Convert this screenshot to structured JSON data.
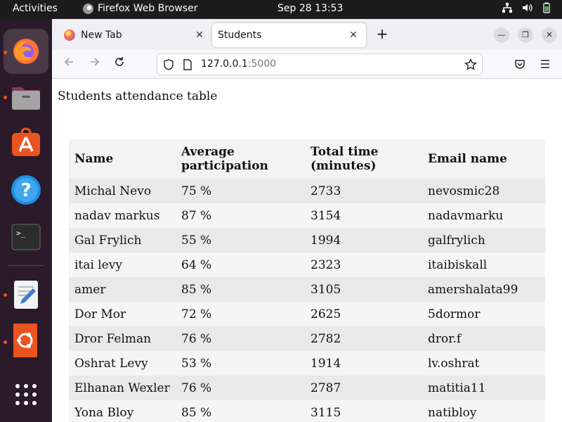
{
  "topbar": {
    "activities": "Activities",
    "app_name": "Firefox Web Browser",
    "datetime": "Sep 28  13:53"
  },
  "dock": {
    "items": [
      "firefox-icon",
      "files-icon",
      "app-center-icon",
      "help-icon",
      "terminal-icon",
      "text-editor-icon",
      "ubuntu-software-icon",
      "show-apps-icon"
    ]
  },
  "browser": {
    "tabs": [
      {
        "label": "New Tab",
        "active": false
      },
      {
        "label": "Students",
        "active": true
      }
    ],
    "url_host": "127.0.0.1",
    "url_port": ":5000"
  },
  "page": {
    "title": "Students attendance table",
    "table": {
      "headers": [
        "Name",
        "Average participation",
        "Total time (minutes)",
        "Email name"
      ],
      "rows": [
        [
          "Michal Nevo",
          "75 %",
          "2733",
          "nevosmic28"
        ],
        [
          "nadav markus",
          "87 %",
          "3154",
          "nadavmarku"
        ],
        [
          "Gal Frylich",
          "55 %",
          "1994",
          "galfrylich"
        ],
        [
          "itai levy",
          "64 %",
          "2323",
          "itaibiskall"
        ],
        [
          "amer",
          "85 %",
          "3105",
          "amershalata99"
        ],
        [
          "Dor Mor",
          "72 %",
          "2625",
          "5dormor"
        ],
        [
          "Dror Felman",
          "76 %",
          "2782",
          "dror.f"
        ],
        [
          "Oshrat Levy",
          "53 %",
          "1914",
          "lv.oshrat"
        ],
        [
          "Elhanan Wexler",
          "76 %",
          "2787",
          "matitia11"
        ],
        [
          "Yona Bloy",
          "85 %",
          "3115",
          "natibloy"
        ]
      ]
    }
  }
}
